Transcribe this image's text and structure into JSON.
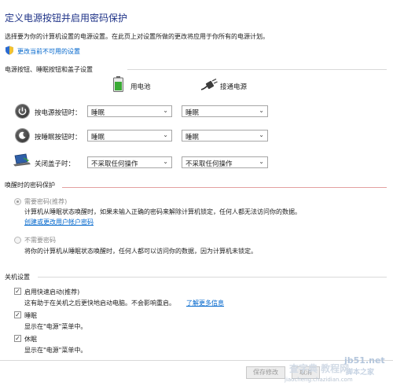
{
  "header": {
    "title": "定义电源按钮并启用密码保护",
    "description": "选择要为你的计算机设置的电源设置。在此页上对设置所做的更改将应用于你所有的电源计划。",
    "change_unavailable_link": "更改当前不可用的设置"
  },
  "power_buttons": {
    "section_title": "电源按钮、睡眠按钮和盖子设置",
    "battery_label": "用电池",
    "plugged_label": "接通电源",
    "rows": [
      {
        "label": "按电源按钮时：",
        "battery": "睡眠",
        "plugged": "睡眠",
        "icon": "power-icon"
      },
      {
        "label": "按睡眠按钮时：",
        "battery": "睡眠",
        "plugged": "睡眠",
        "icon": "sleep-icon"
      },
      {
        "label": "关闭盖子时：",
        "battery": "不采取任何操作",
        "plugged": "不采取任何操作",
        "icon": "laptop-lid-icon"
      }
    ]
  },
  "wake_password": {
    "section_title": "唤醒时的密码保护",
    "option_require": "需要密码(推荐)",
    "option_require_desc": "计算机从睡眠状态唤醒时，如果未输入正确的密码来解除计算机锁定，任何人都无法访问你的数据。",
    "create_password_link": "创建或更改用户帐户密码",
    "option_none": "不需要密码",
    "option_none_desc": "将你的计算机从睡眠状态唤醒时，任何人都可以访问你的数据，因为计算机未锁定。",
    "selected": "require"
  },
  "shutdown": {
    "section_title": "关机设置",
    "fast_startup_label": "启用快速启动(推荐)",
    "fast_startup_desc": "这有助于在关机之后更快地启动电脑。不会影响重启。",
    "learn_more_link": "了解更多信息",
    "sleep_label": "睡眠",
    "sleep_desc": "显示在\"电源\"菜单中。",
    "hibernate_label": "休眠",
    "hibernate_desc": "显示在\"电源\"菜单中。",
    "fast_startup_checked": true,
    "sleep_checked": true,
    "hibernate_checked": true
  },
  "footer": {
    "save_label": "保存修改",
    "cancel_label": "取消"
  },
  "watermark": {
    "site_text": "jb51.net",
    "site_sub": "脚本之家",
    "tutorial_text": "查字典 教程网",
    "url_text": "jiaocheng.chazidian.com"
  },
  "colors": {
    "title": "#1e3287",
    "link": "#0066cc",
    "separator_red": "#e3a0a0",
    "battery_green": "#3aaa35"
  }
}
